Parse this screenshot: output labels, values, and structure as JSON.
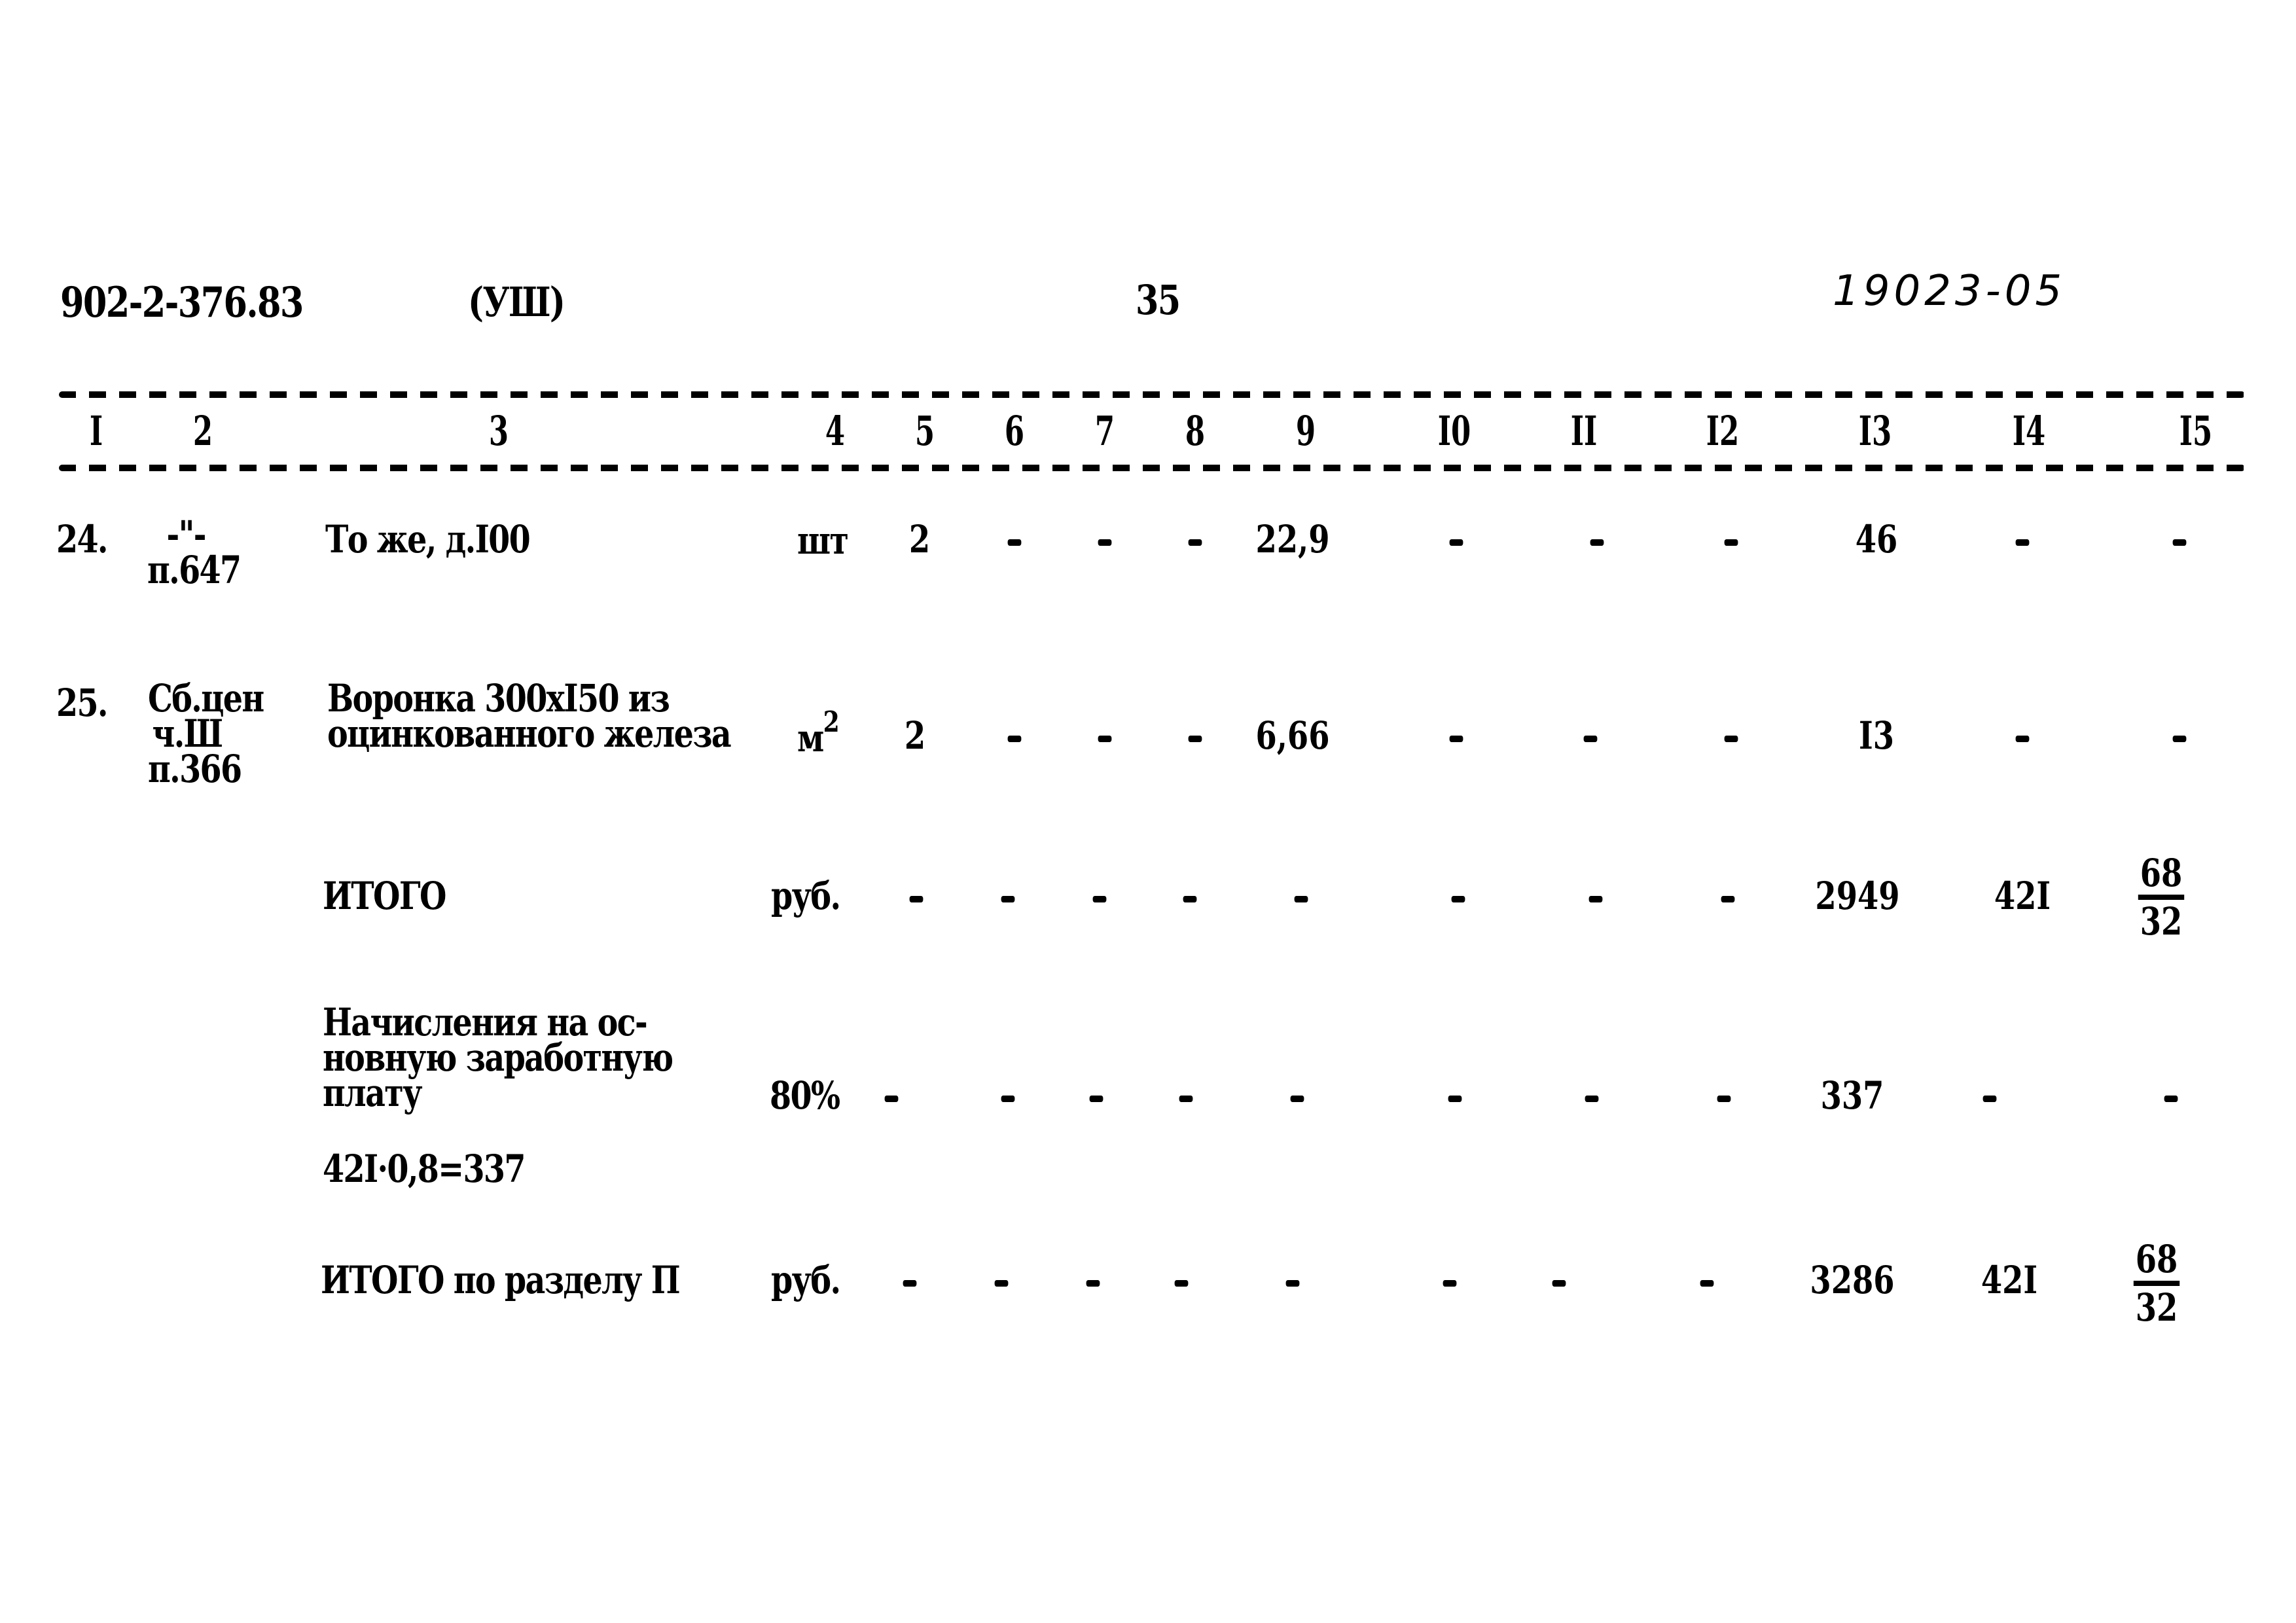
{
  "header": {
    "doc_code": "902-2-376.83",
    "section_marker": "(УШ)",
    "page_number": "35",
    "inventory_number": "19023-05"
  },
  "table": {
    "columns": [
      "I",
      "2",
      "3",
      "4",
      "5",
      "6",
      "7",
      "8",
      "9",
      "I0",
      "II",
      "I2",
      "I3",
      "I4",
      "I5"
    ],
    "rows": [
      {
        "num": "24.",
        "ref": [
          "-\"-",
          "п.647"
        ],
        "desc": [
          "То же, д.I00"
        ],
        "unit": "шт",
        "unit_sup": "",
        "c5": "2",
        "c6": "-",
        "c7": "-",
        "c8": "-",
        "c9": "22,9",
        "c10": "-",
        "c11": "-",
        "c12": "-",
        "c13": "46",
        "c14": "-",
        "c15": "-"
      },
      {
        "num": "25.",
        "ref": [
          "Сб.цен",
          "ч.Ш",
          "п.366"
        ],
        "desc": [
          "Воронка 300хI50 из",
          "оцинкованного железа"
        ],
        "unit": "м",
        "unit_sup": "2",
        "c5": "2",
        "c6": "-",
        "c7": "-",
        "c8": "-",
        "c9": "6,66",
        "c10": "-",
        "c11": "-",
        "c12": "-",
        "c13": "I3",
        "c14": "-",
        "c15": "-"
      }
    ],
    "totals": [
      {
        "label": [
          "ИТОГО"
        ],
        "unit": "руб.",
        "c5": "-",
        "c6": "-",
        "c7": "-",
        "c8": "-",
        "c9": "-",
        "c10": "-",
        "c11": "-",
        "c12": "-",
        "c13": "2949",
        "c14": "42I",
        "c15_num": "68",
        "c15_den": "32"
      },
      {
        "label": [
          "Начисления на ос-",
          "новную заработную",
          "плату"
        ],
        "unit": "80%",
        "c5": "-",
        "c6": "-",
        "c7": "-",
        "c8": "-",
        "c9": "-",
        "c10": "-",
        "c11": "-",
        "c12": "-",
        "c13": "337",
        "c14": "-",
        "c15": "-",
        "formula": "42I·0,8=337"
      },
      {
        "label": [
          "ИТОГО по разделу П"
        ],
        "unit": "руб.",
        "c5": "-",
        "c6": "-",
        "c7": "-",
        "c8": "-",
        "c9": "-",
        "c10": "-",
        "c11": "-",
        "c12": "-",
        "c13": "3286",
        "c14": "42I",
        "c15_num": "68",
        "c15_den": "32"
      }
    ]
  }
}
